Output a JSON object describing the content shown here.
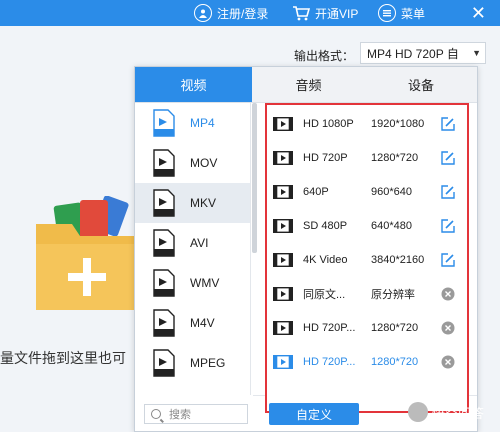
{
  "topbar": {
    "register_label": "注册/登录",
    "vip_label": "开通VIP",
    "menu_label": "菜单",
    "close_glyph": "✕",
    "bg_color": "#2b8ce8"
  },
  "output": {
    "label": "输出格式：",
    "value": "MP4  HD 720P 自",
    "arrow": "▼"
  },
  "drag_hint": "量文件拖到这里也可",
  "popup": {
    "tabs": [
      {
        "label": "视频",
        "active": true
      },
      {
        "label": "音频",
        "active": false
      },
      {
        "label": "设备",
        "active": false
      }
    ],
    "formats": [
      {
        "label": "MP4",
        "active": true,
        "icon_text": "MP4"
      },
      {
        "label": "MOV",
        "active": false,
        "icon_text": "MOV"
      },
      {
        "label": "MKV",
        "active": false,
        "icon_text": "MKV"
      },
      {
        "label": "AVI",
        "active": false,
        "icon_text": "AVI"
      },
      {
        "label": "WMV",
        "active": false,
        "icon_text": "WMV"
      },
      {
        "label": "M4V",
        "active": false,
        "icon_text": "M4V"
      },
      {
        "label": "MPEG",
        "active": false,
        "icon_text": "MPEG"
      }
    ],
    "search_placeholder": "搜索",
    "presets": [
      {
        "name": "HD 1080P",
        "resolution": "1920*1080",
        "action": "edit-icon"
      },
      {
        "name": "HD 720P",
        "resolution": "1280*720",
        "action": "edit-icon"
      },
      {
        "name": "640P",
        "resolution": "960*640",
        "action": "edit-icon"
      },
      {
        "name": "SD 480P",
        "resolution": "640*480",
        "action": "edit-icon"
      },
      {
        "name": "4K Video",
        "resolution": "3840*2160",
        "action": "edit-icon"
      },
      {
        "name": "同原文...",
        "resolution": "原分辨率",
        "action": "remove-icon"
      },
      {
        "name": "HD 720P...",
        "resolution": "1280*720",
        "action": "remove-icon"
      },
      {
        "name": "HD 720P...",
        "resolution": "1280*720",
        "action": "remove-icon",
        "highlighted": true
      }
    ],
    "custom_button": "自定义"
  },
  "watermark": "悟空问答",
  "colors": {
    "accent": "#2b8ce8",
    "highlight_border": "#e3343a",
    "folder": "#f0bb4a"
  }
}
